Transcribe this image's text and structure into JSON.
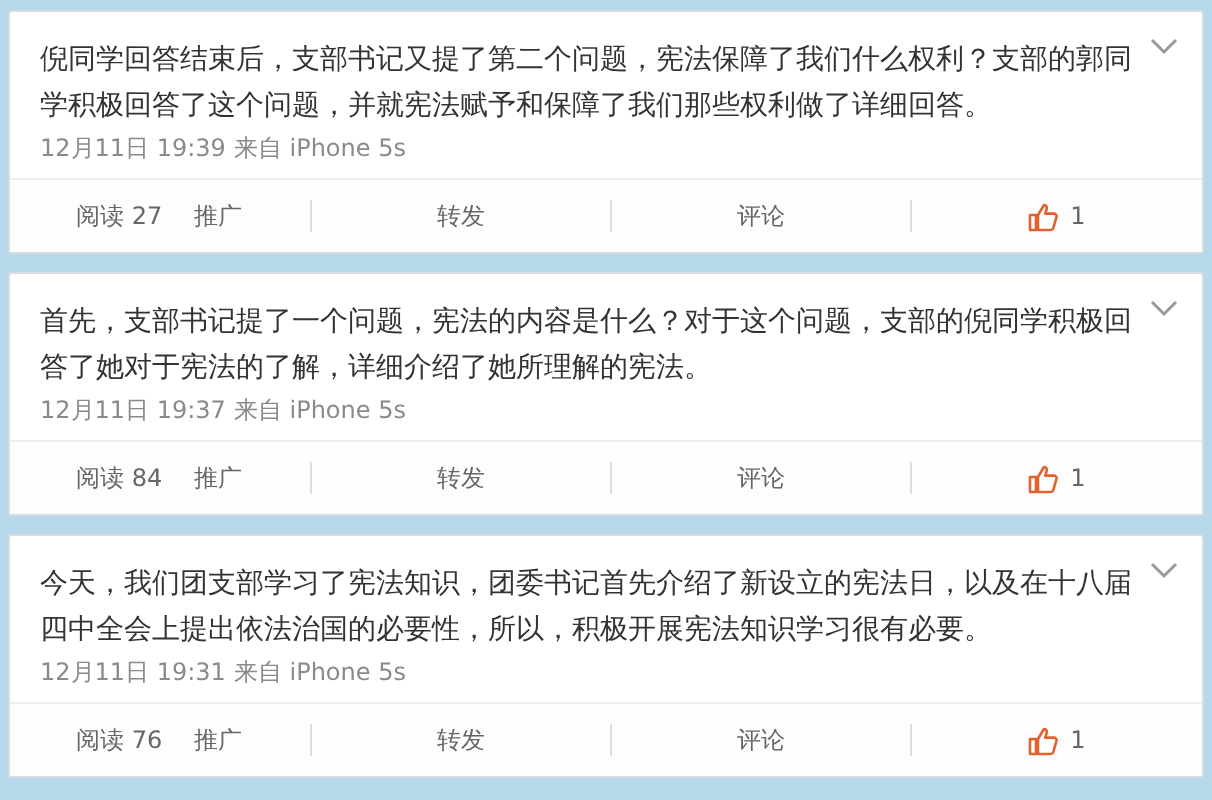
{
  "posts": [
    {
      "text": "倪同学回答结束后，支部书记又提了第二个问题，宪法保障了我们什么权利？支部的郭同学积极回答了这个问题，并就宪法赋予和保障了我们那些权利做了详细回答。",
      "time": "12月11日 19:39",
      "source": "来自 iPhone 5s",
      "reads": "阅读 27",
      "promote": "推广",
      "repost": "转发",
      "comment": "评论",
      "likes": "1"
    },
    {
      "text": "首先，支部书记提了一个问题，宪法的内容是什么？对于这个问题，支部的倪同学积极回答了她对于宪法的了解，详细介绍了她所理解的宪法。",
      "time": "12月11日 19:37",
      "source": "来自 iPhone 5s",
      "reads": "阅读 84",
      "promote": "推广",
      "repost": "转发",
      "comment": "评论",
      "likes": "1"
    },
    {
      "text": "今天，我们团支部学习了宪法知识，团委书记首先介绍了新设立的宪法日，以及在十八届四中全会上提出依法治国的必要性，所以，积极开展宪法知识学习很有必要。",
      "time": "12月11日 19:31",
      "source": "来自 iPhone 5s",
      "reads": "阅读 76",
      "promote": "推广",
      "repost": "转发",
      "comment": "评论",
      "likes": "1"
    }
  ]
}
